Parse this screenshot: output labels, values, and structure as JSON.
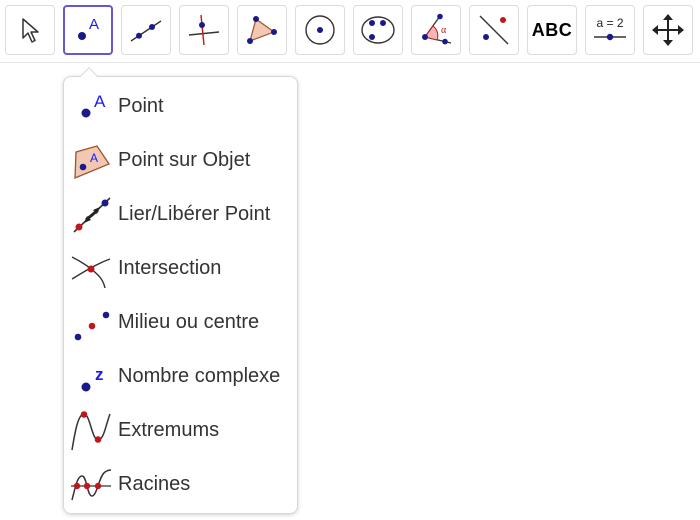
{
  "toolbar": {
    "tools": [
      {
        "name": "move-tool-icon"
      },
      {
        "name": "point-tool-icon",
        "label": "A"
      },
      {
        "name": "line-tool-icon"
      },
      {
        "name": "perpendicular-line-tool-icon"
      },
      {
        "name": "polygon-tool-icon"
      },
      {
        "name": "circle-tool-icon"
      },
      {
        "name": "ellipse-tool-icon"
      },
      {
        "name": "angle-tool-icon",
        "label": "α"
      },
      {
        "name": "reflect-tool-icon"
      },
      {
        "name": "text-tool-icon",
        "label": "ABC"
      },
      {
        "name": "slider-tool-icon",
        "label": "a = 2"
      },
      {
        "name": "move-graphics-view-icon"
      }
    ]
  },
  "menu": {
    "items": [
      {
        "label": "Point",
        "icon": "point-icon",
        "icon_label": "A"
      },
      {
        "label": "Point sur Objet",
        "icon": "point-on-object-icon",
        "icon_label": "A"
      },
      {
        "label": "Lier/Libérer Point",
        "icon": "attach-detach-point-icon"
      },
      {
        "label": "Intersection",
        "icon": "intersection-icon"
      },
      {
        "label": "Milieu ou centre",
        "icon": "midpoint-icon"
      },
      {
        "label": "Nombre complexe",
        "icon": "complex-number-icon",
        "icon_label": "z"
      },
      {
        "label": "Extremums",
        "icon": "extremum-icon"
      },
      {
        "label": "Racines",
        "icon": "roots-icon"
      }
    ]
  },
  "colors": {
    "accent": "#6557d2",
    "point_blue": "#1a1a8c",
    "label_blue": "#1b1bf5",
    "point_red": "#c0171c",
    "polygon_fill": "#f0c8b4",
    "polygon_stroke": "#a0522d"
  }
}
